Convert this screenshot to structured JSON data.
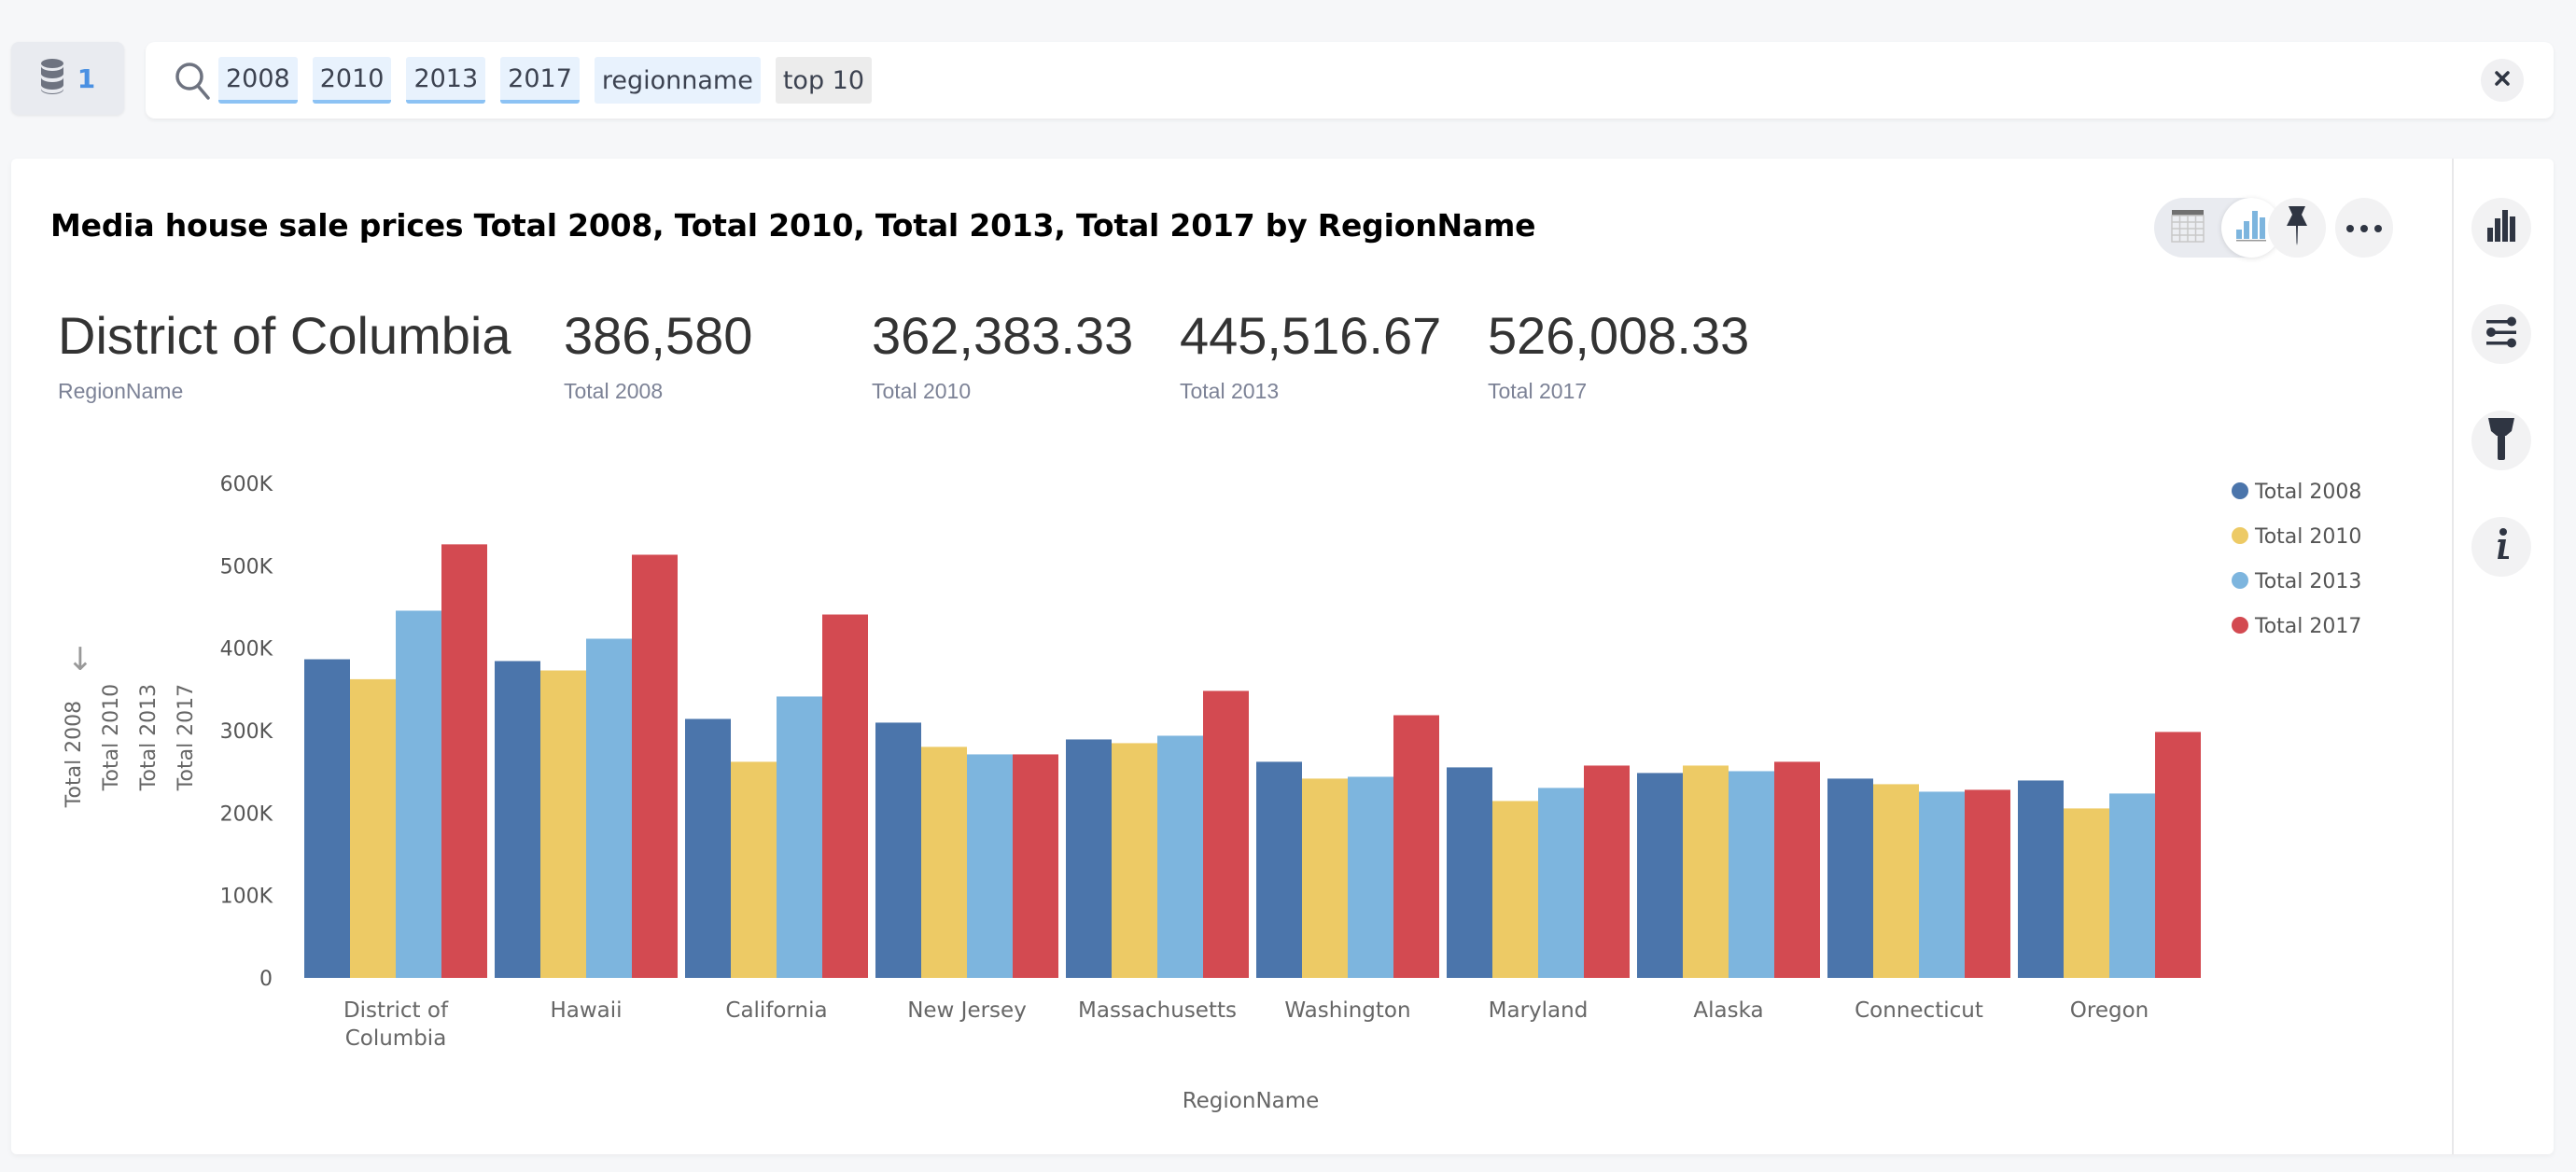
{
  "top_bar": {
    "data_sources_count": "1",
    "search_tokens": [
      {
        "text": "2008",
        "kind": "column"
      },
      {
        "text": "2010",
        "kind": "column"
      },
      {
        "text": "2013",
        "kind": "column"
      },
      {
        "text": "2017",
        "kind": "column"
      },
      {
        "text": "regionname",
        "kind": "attribute"
      },
      {
        "text": "top 10",
        "kind": "keyword"
      }
    ]
  },
  "answer": {
    "title": "Media house sale prices Total 2008, Total 2010, Total 2013, Total 2017 by RegionName",
    "headline": [
      {
        "value": "District of Columbia",
        "label": "RegionName"
      },
      {
        "value": "386,580",
        "label": "Total 2008"
      },
      {
        "value": "362,383.33",
        "label": "Total 2010"
      },
      {
        "value": "445,516.67",
        "label": "Total 2013"
      },
      {
        "value": "526,008.33",
        "label": "Total 2017"
      }
    ],
    "toolbar": {
      "view_options": [
        "table-view",
        "chart-view"
      ],
      "active_view": "chart-view"
    },
    "right_rail": [
      "chart-type",
      "configure",
      "customize-style",
      "info"
    ]
  },
  "colors": {
    "Total 2008": "#4b75ab",
    "Total 2010": "#edca65",
    "Total 2013": "#7db5de",
    "Total 2017": "#d34a51",
    "accent": "#4a90e2"
  },
  "chart_data": {
    "type": "bar",
    "title": "Media house sale prices Total 2008, Total 2010, Total 2013, Total 2017 by RegionName",
    "xlabel": "RegionName",
    "ylabel_series": [
      "Total 2008",
      "Total 2010",
      "Total 2013",
      "Total 2017"
    ],
    "ylabel_sort_indicator": "↓",
    "ylim": [
      0,
      600000
    ],
    "yticks": [
      0,
      100000,
      200000,
      300000,
      400000,
      500000,
      600000
    ],
    "ytick_labels": [
      "0",
      "100K",
      "200K",
      "300K",
      "400K",
      "500K",
      "600K"
    ],
    "grid": false,
    "legend_position": "top-right",
    "categories": [
      "District of Columbia",
      "Hawaii",
      "California",
      "New Jersey",
      "Massachusetts",
      "Washington",
      "Maryland",
      "Alaska",
      "Connecticut",
      "Oregon"
    ],
    "category_lines": [
      [
        "District of",
        "Columbia"
      ],
      [
        "Hawaii"
      ],
      [
        "California"
      ],
      [
        "New Jersey"
      ],
      [
        "Massachusetts"
      ],
      [
        "Washington"
      ],
      [
        "Maryland"
      ],
      [
        "Alaska"
      ],
      [
        "Connecticut"
      ],
      [
        "Oregon"
      ]
    ],
    "series": [
      {
        "name": "Total 2008",
        "values": [
          386580,
          384400,
          314200,
          309700,
          289300,
          262200,
          255400,
          248600,
          241800,
          239500
        ]
      },
      {
        "name": "Total 2010",
        "values": [
          362383.33,
          373000,
          262200,
          280300,
          284800,
          241800,
          214600,
          257600,
          235000,
          205600
        ]
      },
      {
        "name": "Total 2013",
        "values": [
          445516.67,
          411500,
          341400,
          271200,
          293800,
          244000,
          230500,
          250800,
          225900,
          223700
        ]
      },
      {
        "name": "Total 2017",
        "values": [
          526008.33,
          513400,
          440900,
          271200,
          348200,
          318700,
          257600,
          262200,
          228200,
          298400
        ]
      }
    ]
  }
}
